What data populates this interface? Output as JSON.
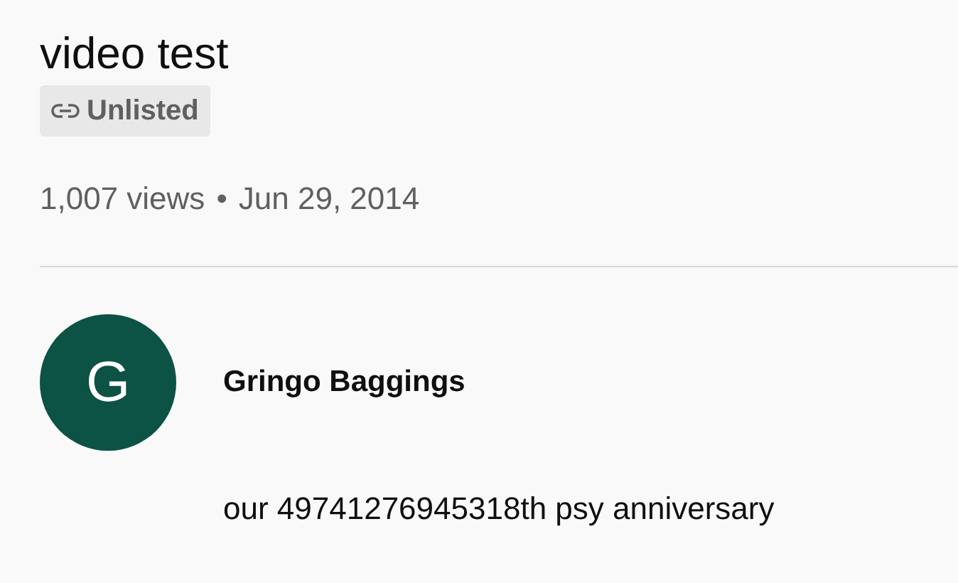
{
  "video": {
    "title": "video test",
    "visibility": {
      "kind": "unlisted",
      "label": "Unlisted"
    },
    "views": "1,007 views",
    "separator": "•",
    "date": "Jun 29, 2014"
  },
  "channel": {
    "avatar_letter": "G",
    "name": "Gringo Baggings"
  },
  "description": "our 49741276945318th psy anniversary"
}
